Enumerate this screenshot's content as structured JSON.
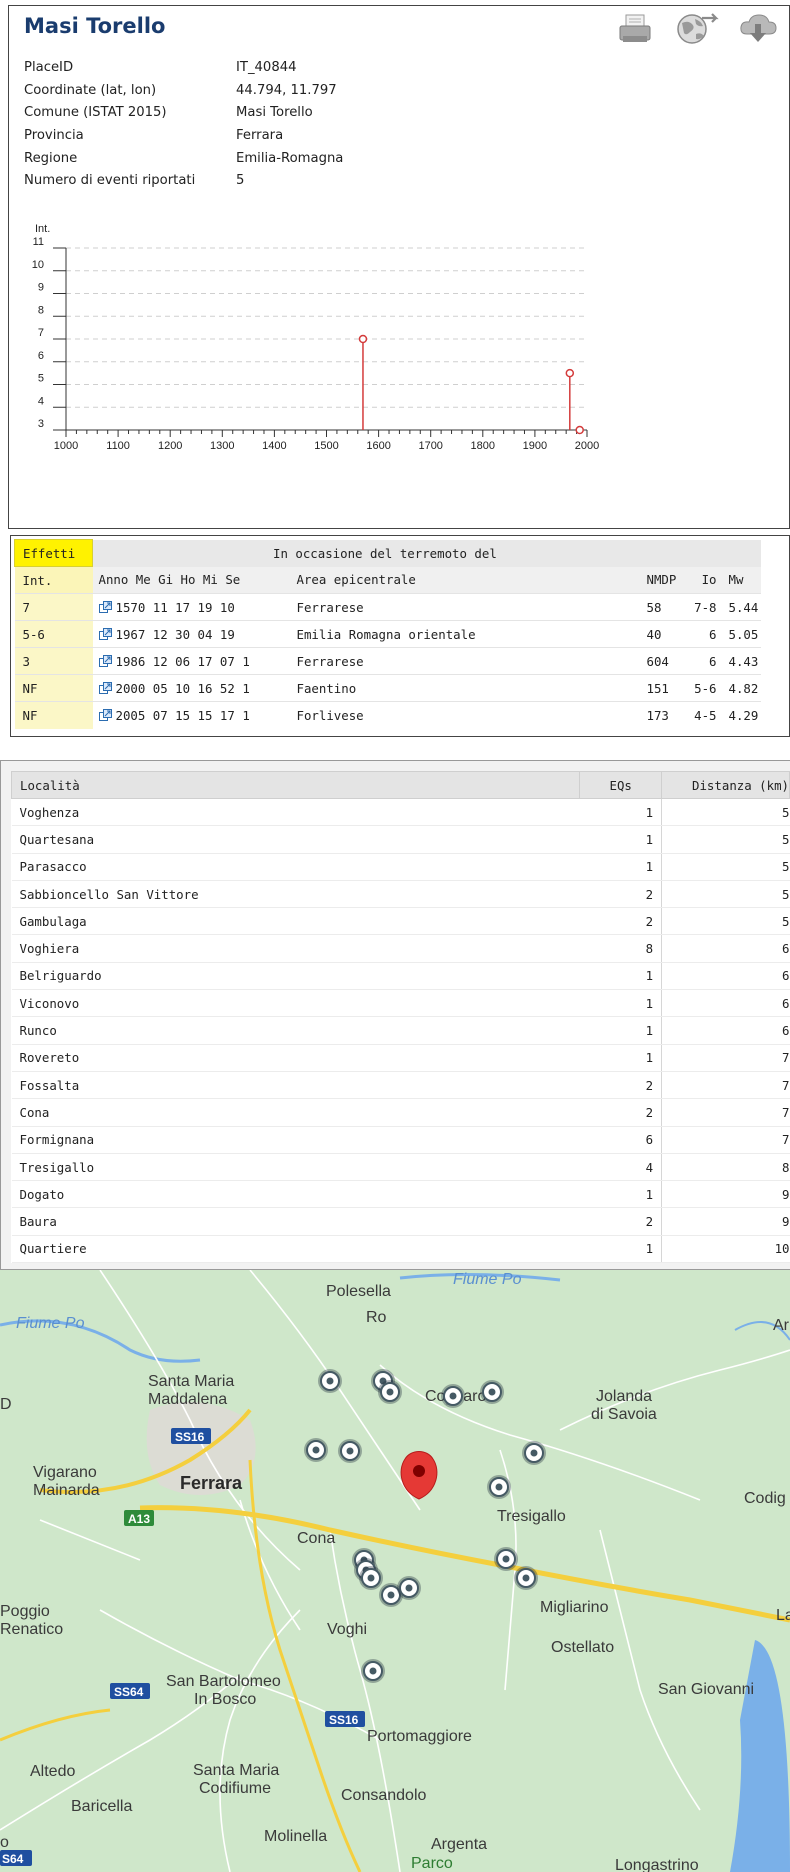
{
  "place": {
    "title": "Masi Torello",
    "info": [
      {
        "label": "PlaceID",
        "value": "IT_40844"
      },
      {
        "label": "Coordinate (lat, lon)",
        "value": "44.794, 11.797"
      },
      {
        "label": "Comune (ISTAT 2015)",
        "value": "Masi Torello"
      },
      {
        "label": "Provincia",
        "value": "Ferrara"
      },
      {
        "label": "Regione",
        "value": "Emilia-Romagna"
      },
      {
        "label": "Numero di eventi riportati",
        "value": "5"
      }
    ],
    "icons": [
      "print-icon",
      "globe-icon",
      "download-icon"
    ]
  },
  "chart_data": {
    "type": "scatter",
    "ylabel": "Int.",
    "xlim": [
      1000,
      2000
    ],
    "ylim": [
      3,
      11
    ],
    "x_ticks": [
      1000,
      1100,
      1200,
      1300,
      1400,
      1500,
      1600,
      1700,
      1800,
      1900,
      2000
    ],
    "y_ticks": [
      3,
      4,
      5,
      6,
      7,
      8,
      9,
      10,
      11
    ],
    "grid": "horizontal dashed",
    "color": "#d43b3b",
    "points": [
      {
        "x": 1570,
        "y": 7
      },
      {
        "x": 1967,
        "y": 5.5
      },
      {
        "x": 1986,
        "y": 3
      }
    ]
  },
  "effects": {
    "header_effetti": "Effetti",
    "header_event": "In occasione del terremoto del",
    "columns": {
      "int": "Int.",
      "date": "Anno Me Gi Ho Mi Se",
      "area": "Area epicentrale",
      "nmdp": "NMDP",
      "io": "Io",
      "mw": "Mw"
    },
    "rows": [
      {
        "int": "7",
        "date": "1570 11 17 19 10",
        "area": "Ferrarese",
        "nmdp": "58",
        "io": "7-8",
        "mw": "5.44"
      },
      {
        "int": "5-6",
        "date": "1967 12 30 04 19",
        "area": "Emilia Romagna orientale",
        "nmdp": "40",
        "io": "6",
        "mw": "5.05"
      },
      {
        "int": "3",
        "date": "1986 12 06 17 07 1",
        "area": "Ferrarese",
        "nmdp": "604",
        "io": "6",
        "mw": "4.43"
      },
      {
        "int": "NF",
        "date": "2000 05 10 16 52 1",
        "area": "Faentino",
        "nmdp": "151",
        "io": "5-6",
        "mw": "4.82"
      },
      {
        "int": "NF",
        "date": "2005 07 15 15 17 1",
        "area": "Forlivese",
        "nmdp": "173",
        "io": "4-5",
        "mw": "4.29"
      }
    ]
  },
  "nearby": {
    "columns": {
      "loc": "Località",
      "eqs": "EQs",
      "dist": "Distanza (km)"
    },
    "rows": [
      {
        "loc": "Voghenza",
        "eqs": "1",
        "dist": "5"
      },
      {
        "loc": "Quartesana",
        "eqs": "1",
        "dist": "5"
      },
      {
        "loc": "Parasacco",
        "eqs": "1",
        "dist": "5"
      },
      {
        "loc": "Sabbioncello San Vittore",
        "eqs": "2",
        "dist": "5"
      },
      {
        "loc": "Gambulaga",
        "eqs": "2",
        "dist": "5"
      },
      {
        "loc": "Voghiera",
        "eqs": "8",
        "dist": "6"
      },
      {
        "loc": "Belriguardo",
        "eqs": "1",
        "dist": "6"
      },
      {
        "loc": "Viconovo",
        "eqs": "1",
        "dist": "6"
      },
      {
        "loc": "Runco",
        "eqs": "1",
        "dist": "6"
      },
      {
        "loc": "Rovereto",
        "eqs": "1",
        "dist": "7"
      },
      {
        "loc": "Fossalta",
        "eqs": "2",
        "dist": "7"
      },
      {
        "loc": "Cona",
        "eqs": "2",
        "dist": "7"
      },
      {
        "loc": "Formignana",
        "eqs": "6",
        "dist": "7"
      },
      {
        "loc": "Tresigallo",
        "eqs": "4",
        "dist": "8"
      },
      {
        "loc": "Dogato",
        "eqs": "1",
        "dist": "9"
      },
      {
        "loc": "Baura",
        "eqs": "2",
        "dist": "9"
      },
      {
        "loc": "Quartiere",
        "eqs": "1",
        "dist": "10"
      }
    ]
  },
  "map": {
    "labels": {
      "polesella": "Polesella",
      "ro": "Ro",
      "fiume_po_top": "Fiume Po",
      "fiume_po_left": "Fiume Po",
      "santa_maria_1": "Santa Maria",
      "santa_maria_2": "Maddalena",
      "copparo": "Copparo",
      "jolanda_1": "Jolanda",
      "jolanda_2": "di Savoia",
      "ss16_a": "SS16",
      "vigarano_1": "Vigarano",
      "vigarano_2": "Mainarda",
      "ferrara": "Ferrara",
      "a13": "A13",
      "cona": "Cona",
      "tresigallo": "Tresigallo",
      "codigoro": "Codig",
      "poggio_1": "Poggio",
      "poggio_2": "Renatico",
      "voghiera": "Voghi",
      "migliarino": "Migliarino",
      "ostellato": "Ostellato",
      "ss64_a": "SS64",
      "sanbart_1": "San Bartolomeo",
      "sanbart_2": "In Bosco",
      "sangiovanni": "San Giovanni",
      "ss16_b": "SS16",
      "portomaggiore": "Portomaggiore",
      "altedo": "Altedo",
      "smc_1": "Santa Maria",
      "smc_2": "Codifiume",
      "baricella": "Baricella",
      "consandolo": "Consandolo",
      "molinella": "Molinella",
      "argenta": "Argenta",
      "parco": "Parco",
      "ss64_b": "S64",
      "longastrino": "Longastrino",
      "ar": "Ar",
      "la": "La",
      "edge_d": "D",
      "edge_o": "o"
    },
    "colors": {
      "land": "#cde6c8",
      "water": "#7ab0e8",
      "marker": "#e53935",
      "road_major": "#f4cf3e"
    }
  }
}
